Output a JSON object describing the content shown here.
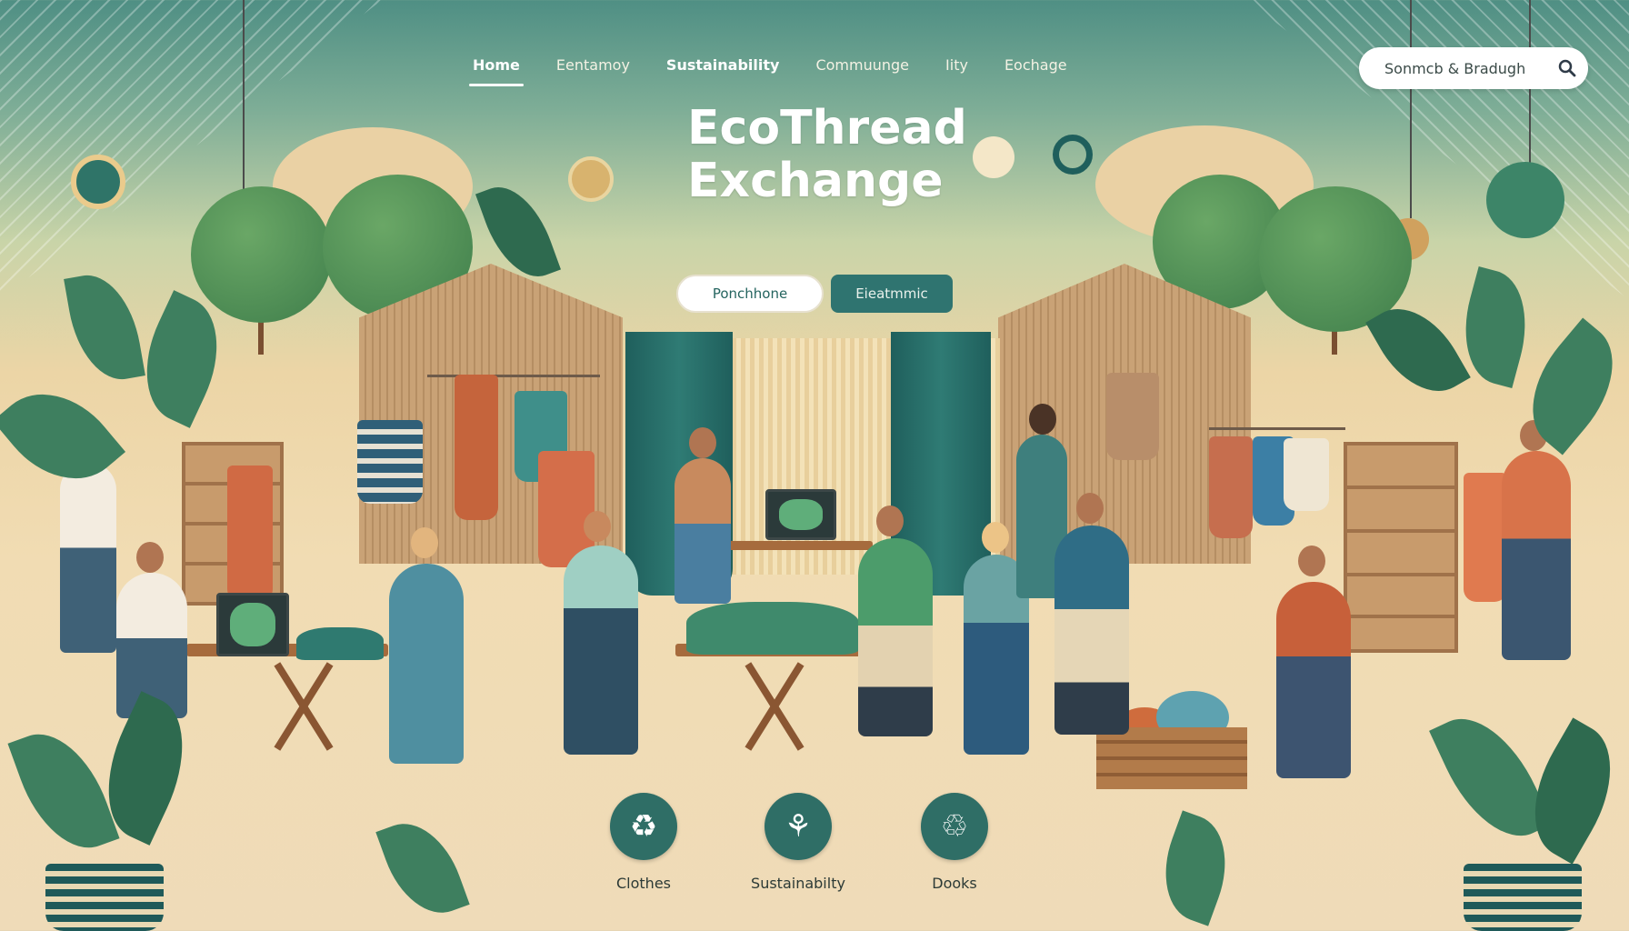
{
  "nav": {
    "items": [
      {
        "label": "Home",
        "active": true
      },
      {
        "label": "Eentamoy",
        "active": false
      },
      {
        "label": "Sustainability",
        "active": false
      },
      {
        "label": "Commuunge",
        "active": false
      },
      {
        "label": "Iity",
        "active": false
      },
      {
        "label": "Eochage",
        "active": false
      }
    ]
  },
  "search": {
    "placeholder": "Sonmcb & Bradugh",
    "icon": "search-icon"
  },
  "hero": {
    "title": "EcoThread\nExchange",
    "primary_button": "Ponchhone",
    "secondary_button": "Eieatmmic"
  },
  "categories": [
    {
      "label": "Clothes",
      "icon": "clothes-recycle-icon",
      "glyph": "♻"
    },
    {
      "label": "Sustainabilty",
      "icon": "sustainability-icon",
      "glyph": "⚘"
    },
    {
      "label": "Dooks",
      "icon": "books-recycle-icon",
      "glyph": "♲"
    }
  ],
  "colors": {
    "accent": "#2f6e66",
    "secondary_button": "#2f7470",
    "sky_top": "#4f8f84",
    "sand": "#efdbb8",
    "foliage": "#3e7f5f"
  }
}
